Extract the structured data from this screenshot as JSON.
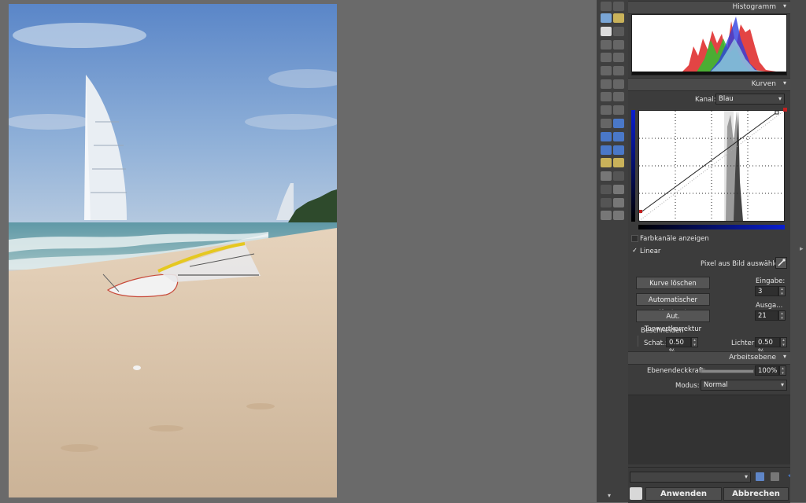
{
  "histogram_panel": {
    "title": "Histogramm"
  },
  "curves_panel": {
    "title": "Kurven",
    "channel_label": "Kanal:",
    "channel_value": "Blau",
    "show_channels_label": "Farbkanäle anzeigen",
    "show_channels_checked": false,
    "linear_label": "Linear",
    "linear_checked": true,
    "linear_check_glyph": "✓",
    "pick_pixel_label": "Pixel aus Bild auswählen:",
    "clear_curve_label": "Kurve löschen",
    "auto_contrast_label": "Automatischer Kontrast",
    "auto_levels_label": "Aut. Tonwertkorrektur",
    "input_label": "Eingabe:",
    "input_value": "3",
    "output_label": "Ausga...",
    "output_value": "21",
    "clip_title": "Beschneiden",
    "shadows_label": "Schat.:",
    "shadows_value": "0.50 %",
    "highlights_label": "Lichter:",
    "highlights_value": "0.50 %"
  },
  "layer_panel": {
    "title": "Arbeitsebene",
    "opacity_label": "Ebenendeckkraft:",
    "opacity_value": "100%",
    "opacity_level": 1.0,
    "mode_label": "Modus:",
    "mode_value": "Normal"
  },
  "footer": {
    "preset_value": "",
    "apply_label": "Anwenden",
    "cancel_label": "Abbrechen"
  },
  "colors": {
    "panel_bg": "#3c3c3c",
    "header_bg": "#4a4a4a",
    "canvas_bg": "#6a6a6a",
    "accent_blue": "#0a1fd0"
  }
}
